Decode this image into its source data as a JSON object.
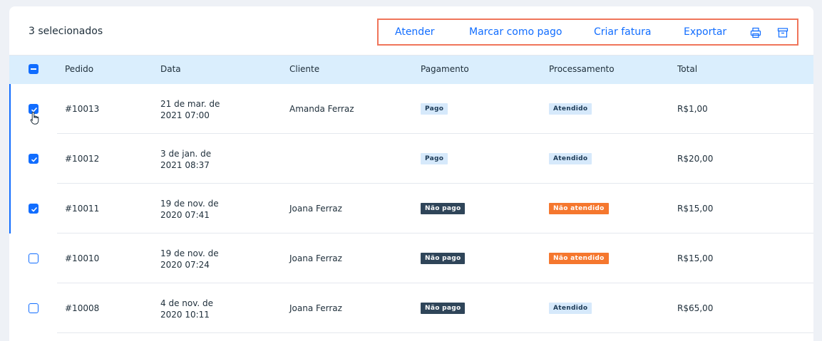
{
  "toolbar": {
    "selected_count": "3 selecionados",
    "actions": [
      "Atender",
      "Marcar como pago",
      "Criar fatura",
      "Exportar"
    ],
    "icons": [
      "printer-icon",
      "archive-icon"
    ],
    "accent_color": "#116dff",
    "highlight_color": "#f0755a"
  },
  "table": {
    "headers": [
      "Pedido",
      "Data",
      "Cliente",
      "Pagamento",
      "Processamento",
      "Total"
    ],
    "rows": [
      {
        "checked": true,
        "order": "#10013",
        "date_line1": "21 de mar. de",
        "date_line2": "2021 07:00",
        "client": "Amanda Ferraz",
        "payment": "Pago",
        "payment_style": "paid",
        "processing": "Atendido",
        "processing_style": "done",
        "total": "R$1,00"
      },
      {
        "checked": true,
        "order": "#10012",
        "date_line1": "3 de jan. de",
        "date_line2": "2021 08:37",
        "client": "",
        "payment": "Pago",
        "payment_style": "paid",
        "processing": "Atendido",
        "processing_style": "done",
        "total": "R$20,00"
      },
      {
        "checked": true,
        "order": "#10011",
        "date_line1": "19 de nov. de",
        "date_line2": "2020 07:41",
        "client": "Joana Ferraz",
        "payment": "Não pago",
        "payment_style": "unpaid",
        "processing": "Não atendido",
        "processing_style": "todo",
        "total": "R$15,00"
      },
      {
        "checked": false,
        "order": "#10010",
        "date_line1": "19 de nov. de",
        "date_line2": "2020 07:24",
        "client": "Joana Ferraz",
        "payment": "Não pago",
        "payment_style": "unpaid",
        "processing": "Não atendido",
        "processing_style": "todo",
        "total": "R$15,00"
      },
      {
        "checked": false,
        "order": "#10008",
        "date_line1": "4 de nov. de",
        "date_line2": "2020 10:11",
        "client": "Joana Ferraz",
        "payment": "Não pago",
        "payment_style": "unpaid",
        "processing": "Atendido",
        "processing_style": "done",
        "total": "R$65,00"
      }
    ]
  },
  "badge_styles": {
    "paid": {
      "bg": "#d6e9fb",
      "fg": "#1c3a56"
    },
    "unpaid": {
      "bg": "#2f4559",
      "fg": "#ffffff"
    },
    "done": {
      "bg": "#d6e9fb",
      "fg": "#1c3a56"
    },
    "todo": {
      "bg": "#f5772e",
      "fg": "#ffffff"
    }
  },
  "cursor_icon": "hand-pointer-icon"
}
